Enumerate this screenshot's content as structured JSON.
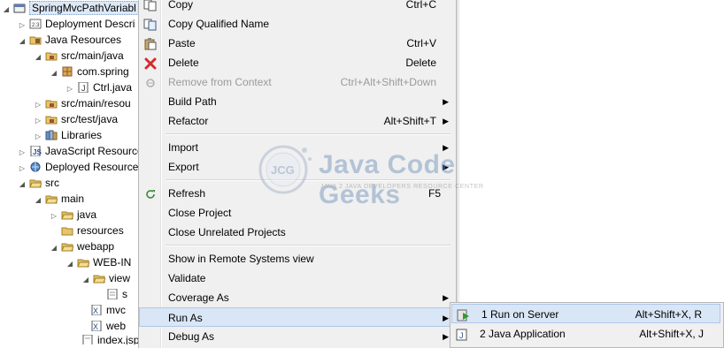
{
  "tree": {
    "items": [
      {
        "label": "SpringMvcPathVariabl",
        "expanded": true,
        "icon": "project-icon"
      },
      {
        "label": "Deployment Descri",
        "expanded": false,
        "icon": "deployment-descriptor-icon"
      },
      {
        "label": "Java Resources",
        "expanded": true,
        "icon": "java-resources-icon"
      },
      {
        "label": "src/main/java",
        "expanded": true,
        "icon": "source-folder-icon"
      },
      {
        "label": "com.spring",
        "expanded": true,
        "icon": "package-icon"
      },
      {
        "label": "Ctrl.java",
        "expanded": false,
        "icon": "java-file-icon"
      },
      {
        "label": "src/main/resou",
        "expanded": false,
        "icon": "source-folder-icon"
      },
      {
        "label": "src/test/java",
        "expanded": false,
        "icon": "source-folder-icon"
      },
      {
        "label": "Libraries",
        "expanded": false,
        "icon": "libraries-icon"
      },
      {
        "label": "JavaScript Resource",
        "expanded": false,
        "icon": "javascript-resources-icon"
      },
      {
        "label": "Deployed Resource",
        "expanded": false,
        "icon": "deployed-resources-icon"
      },
      {
        "label": "src",
        "expanded": true,
        "icon": "folder-icon"
      },
      {
        "label": "main",
        "expanded": true,
        "icon": "folder-icon"
      },
      {
        "label": "java",
        "expanded": false,
        "icon": "folder-icon"
      },
      {
        "label": "resources",
        "expanded": false,
        "icon": "folder-icon"
      },
      {
        "label": "webapp",
        "expanded": true,
        "icon": "folder-icon"
      },
      {
        "label": "WEB-IN",
        "expanded": true,
        "icon": "folder-icon"
      },
      {
        "label": "view",
        "expanded": true,
        "icon": "folder-icon"
      },
      {
        "label": "s",
        "expanded": false,
        "icon": "jsp-file-icon"
      },
      {
        "label": "mvc",
        "expanded": false,
        "icon": "xml-file-icon"
      },
      {
        "label": "web",
        "expanded": false,
        "icon": "xml-file-icon"
      },
      {
        "label": "index.jsp",
        "expanded": false,
        "icon": "jsp-file-icon"
      }
    ]
  },
  "menu": {
    "items": [
      {
        "label": "Copy",
        "shortcut": "Ctrl+C",
        "icon": "copy-icon"
      },
      {
        "label": "Copy Qualified Name",
        "shortcut": "",
        "icon": "copy-qualified-name-icon"
      },
      {
        "label": "Paste",
        "shortcut": "Ctrl+V",
        "icon": "paste-icon"
      },
      {
        "label": "Delete",
        "shortcut": "Delete",
        "icon": "delete-icon"
      },
      {
        "label": "Remove from Context",
        "shortcut": "Ctrl+Alt+Shift+Down",
        "icon": "remove-from-context-icon",
        "disabled": true
      },
      {
        "label": "Build Path",
        "shortcut": "",
        "submenu": true
      },
      {
        "label": "Refactor",
        "shortcut": "Alt+Shift+T",
        "submenu": true
      },
      {
        "label": "Import",
        "shortcut": "",
        "submenu": true
      },
      {
        "label": "Export",
        "shortcut": "",
        "submenu": true
      },
      {
        "label": "Refresh",
        "shortcut": "F5",
        "icon": "refresh-icon"
      },
      {
        "label": "Close Project",
        "shortcut": ""
      },
      {
        "label": "Close Unrelated Projects",
        "shortcut": ""
      },
      {
        "label": "Show in Remote Systems view",
        "shortcut": ""
      },
      {
        "label": "Validate",
        "shortcut": ""
      },
      {
        "label": "Coverage As",
        "shortcut": "",
        "submenu": true
      },
      {
        "label": "Run As",
        "shortcut": "",
        "submenu": true,
        "active": true
      },
      {
        "label": "Debug As",
        "shortcut": "",
        "submenu": true
      }
    ]
  },
  "submenu": {
    "items": [
      {
        "label": "1 Run on Server",
        "shortcut": "Alt+Shift+X, R",
        "icon": "run-on-server-icon"
      },
      {
        "label": "2 Java Application",
        "shortcut": "Alt+Shift+X, J",
        "icon": "java-application-icon"
      }
    ]
  },
  "watermark": {
    "logo_text": "JCG",
    "title": "Java Code Geeks",
    "subtitle": "JAVA 2 JAVA DEVELOPERS RESOURCE CENTER"
  },
  "colors": {
    "menu_background": "#f0f0f0",
    "highlight": "#d9e6f6",
    "folder": "#e8c46a",
    "watermark_blue": "#6a8db8"
  }
}
